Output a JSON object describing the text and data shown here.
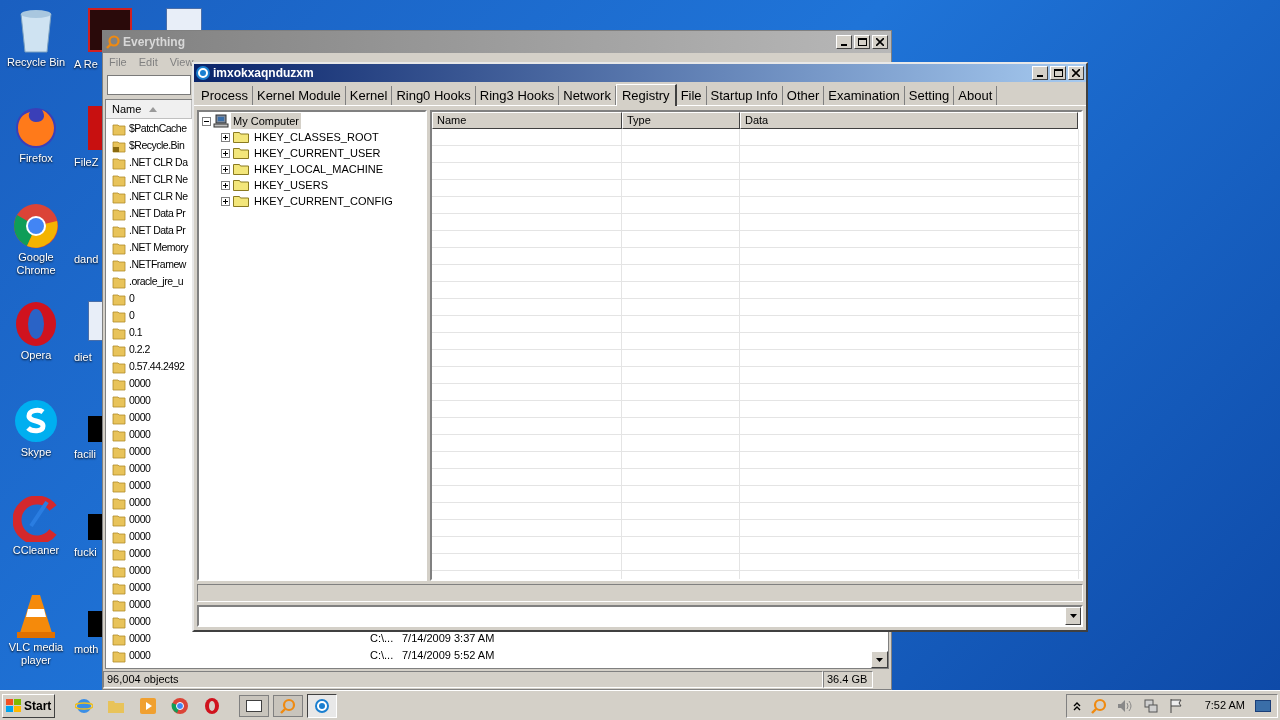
{
  "desktop": {
    "icons": [
      {
        "label": "Recycle Bin",
        "kind": "bin"
      },
      {
        "label": "Firefox",
        "kind": "fox"
      },
      {
        "label": "Google Chrome",
        "kind": "chrome"
      },
      {
        "label": "Opera",
        "kind": "opera"
      },
      {
        "label": "Skype",
        "kind": "skype"
      },
      {
        "label": "CCleaner",
        "kind": "ccleaner"
      },
      {
        "label": "VLC media player",
        "kind": "cone"
      }
    ],
    "icons_col2": [
      {
        "label": "A Re",
        "kind": "dark"
      },
      {
        "label": "FileZ",
        "kind": "red"
      },
      {
        "label": "dand",
        "kind": "none"
      },
      {
        "label": "diet",
        "kind": "doc"
      },
      {
        "label": "facili",
        "kind": "black"
      },
      {
        "label": "fucki",
        "kind": "black"
      },
      {
        "label": "moth",
        "kind": "black"
      }
    ]
  },
  "everything": {
    "title": "Everything",
    "menu": [
      "File",
      "Edit",
      "View"
    ],
    "column": "Name",
    "rows": [
      {
        "name": "$PatchCache",
        "kind": "folder"
      },
      {
        "name": "$Recycle.Bin",
        "kind": "locked"
      },
      {
        "name": ".NET CLR Da",
        "kind": "folder"
      },
      {
        "name": ".NET CLR Ne",
        "kind": "folder"
      },
      {
        "name": ".NET CLR Ne",
        "kind": "folder"
      },
      {
        "name": ".NET Data Pr",
        "kind": "folder"
      },
      {
        "name": ".NET Data Pr",
        "kind": "folder"
      },
      {
        "name": ".NET Memory",
        "kind": "folder"
      },
      {
        "name": ".NETFramew",
        "kind": "folder"
      },
      {
        "name": ".oracle_jre_u",
        "kind": "folder"
      },
      {
        "name": "0",
        "kind": "folder"
      },
      {
        "name": "0",
        "kind": "folder"
      },
      {
        "name": "0.1",
        "kind": "folder"
      },
      {
        "name": "0.2.2",
        "kind": "folder"
      },
      {
        "name": "0.57.44.2492",
        "kind": "folder"
      },
      {
        "name": "0000",
        "kind": "folder"
      },
      {
        "name": "0000",
        "kind": "folder"
      },
      {
        "name": "0000",
        "kind": "folder"
      },
      {
        "name": "0000",
        "kind": "folder"
      },
      {
        "name": "0000",
        "kind": "folder"
      },
      {
        "name": "0000",
        "kind": "folder"
      },
      {
        "name": "0000",
        "kind": "folder"
      },
      {
        "name": "0000",
        "kind": "folder"
      },
      {
        "name": "0000",
        "kind": "folder"
      },
      {
        "name": "0000",
        "kind": "folder"
      },
      {
        "name": "0000",
        "kind": "folder"
      },
      {
        "name": "0000",
        "kind": "folder"
      },
      {
        "name": "0000",
        "kind": "folder"
      },
      {
        "name": "0000",
        "kind": "folder"
      },
      {
        "name": "0000",
        "kind": "folder"
      },
      {
        "name": "0000",
        "kind": "folder",
        "path": "C:\\...",
        "modified": "7/14/2009 3:37 AM"
      },
      {
        "name": "0000",
        "kind": "folder",
        "path": "C:\\...",
        "modified": "7/14/2009 5:52 AM"
      }
    ],
    "status": "96,004 objects",
    "size": "36.4 GB"
  },
  "tool": {
    "title": "imxokxaqnduzxm",
    "tabs": [
      {
        "label": "Process",
        "selected": false
      },
      {
        "label": "Kernel Module",
        "selected": false
      },
      {
        "label": "Kernel",
        "selected": false
      },
      {
        "label": "Ring0 Hooks",
        "selected": false
      },
      {
        "label": "Ring3 Hooks",
        "selected": false
      },
      {
        "label": "Network",
        "selected": false
      },
      {
        "label": "Registry",
        "selected": true
      },
      {
        "label": "File",
        "selected": false
      },
      {
        "label": "Startup Info",
        "selected": false
      },
      {
        "label": "Other",
        "selected": false
      },
      {
        "label": "Examination",
        "selected": false
      },
      {
        "label": "Setting",
        "selected": false
      },
      {
        "label": "About",
        "selected": false
      }
    ],
    "tree": {
      "label": "My Computer",
      "expanded": true,
      "selected": true,
      "children": [
        {
          "label": "HKEY_CLASSES_ROOT",
          "expanded": false,
          "selected": false
        },
        {
          "label": "HKEY_CURRENT_USER",
          "expanded": false,
          "selected": false
        },
        {
          "label": "HKEY_LOCAL_MACHINE",
          "expanded": false,
          "selected": false
        },
        {
          "label": "HKEY_USERS",
          "expanded": false,
          "selected": false
        },
        {
          "label": "HKEY_CURRENT_CONFIG",
          "expanded": false,
          "selected": false
        }
      ]
    },
    "table": {
      "columns": [
        "Name",
        "Type",
        "Data"
      ]
    }
  },
  "taskbar": {
    "start": "Start",
    "clock": "7:52 AM"
  }
}
